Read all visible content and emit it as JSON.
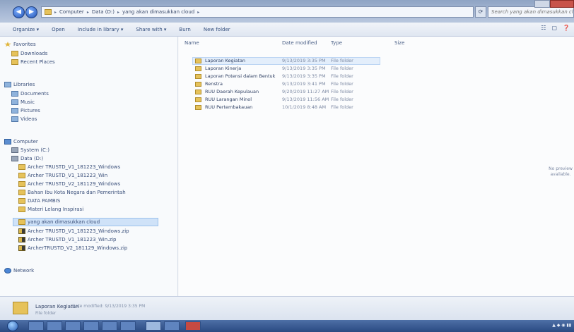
{
  "window": {
    "breadcrumbs": [
      "Computer",
      "Data (D:)",
      "yang akan dimasukkan cloud"
    ],
    "search_placeholder": "Search yang akan dimasukkan cloud"
  },
  "toolbar": {
    "items": [
      "Organize ▾",
      "Open",
      "Include in library ▾",
      "Share with ▾",
      "Burn",
      "New folder"
    ]
  },
  "nav": {
    "favorites": {
      "label": "Favorites",
      "items": [
        "Downloads",
        "Recent Places"
      ]
    },
    "libraries": {
      "label": "Libraries",
      "items": [
        "Documents",
        "Music",
        "Pictures",
        "Videos"
      ]
    },
    "computer": {
      "label": "Computer",
      "drives": [
        "System (C:)",
        "Data (D:)"
      ],
      "folders": [
        "Archer TRUSTD_V1_181223_Windows",
        "Archer TRUSTD_V1_181223_Win",
        "Archer TRUSTD_V2_181129_Windows",
        "Bahan Ibu Kota Negara dan Pemerintah",
        "DATA PAMBIS",
        "Materi Lelang Inspirasi",
        "yang akan dimasukkan cloud",
        "Archer TRUSTD_V1_181223_Windows.zip",
        "Archer TRUSTD_V1_181223_Win.zip",
        "ArcherTRUSTD_V2_181129_Windows.zip"
      ]
    },
    "network": {
      "label": "Network"
    }
  },
  "columns": {
    "name": "Name",
    "date": "Date modified",
    "type": "Type",
    "size": "Size"
  },
  "files": [
    {
      "name": "Laporan Kegiatan",
      "date": "9/13/2019 3:35 PM",
      "type": "File folder"
    },
    {
      "name": "Laporan Kinerja",
      "date": "9/13/2019 3:35 PM",
      "type": "File folder"
    },
    {
      "name": "Laporan Potensi dalam Bentuk",
      "date": "9/13/2019 3:35 PM",
      "type": "File folder"
    },
    {
      "name": "Renstra",
      "date": "9/13/2019 3:41 PM",
      "type": "File folder"
    },
    {
      "name": "RUU Daerah Kepulauan",
      "date": "9/20/2019 11:27 AM",
      "type": "File folder"
    },
    {
      "name": "RUU Larangan Minol",
      "date": "9/13/2019 11:56 AM",
      "type": "File folder"
    },
    {
      "name": "RUU Pertembakauan",
      "date": "10/1/2019 8:48 AM",
      "type": "File folder"
    }
  ],
  "preview": {
    "text": "No preview available."
  },
  "details": {
    "name": "Laporan Kegiatan",
    "meta": "Date modified: 9/13/2019 3:35 PM",
    "type": "File folder"
  }
}
